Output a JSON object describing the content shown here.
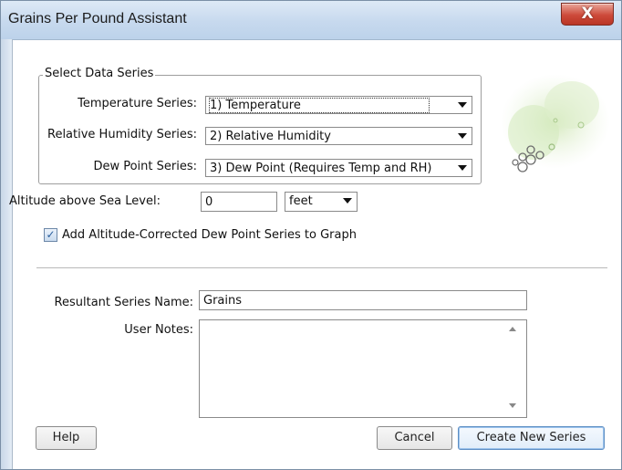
{
  "window": {
    "title": "Grains Per Pound Assistant",
    "close_glyph": "X"
  },
  "series_group": {
    "legend": "Select Data Series",
    "temperature": {
      "label": "Temperature Series:",
      "value": "1) Temperature"
    },
    "humidity": {
      "label": "Relative Humidity Series:",
      "value": "2) Relative Humidity"
    },
    "dew_point": {
      "label": "Dew Point Series:",
      "value": "3) Dew Point (Requires Temp and RH)"
    }
  },
  "altitude": {
    "label": "Altitude above Sea Level:",
    "value": "0",
    "unit": "feet"
  },
  "altitude_corrected": {
    "label": "Add Altitude-Corrected Dew Point Series to Graph",
    "checked": true,
    "check_glyph": "✓"
  },
  "resultant": {
    "label": "Resultant Series Name:",
    "value": "Grains"
  },
  "notes": {
    "label": "User Notes:",
    "value": ""
  },
  "buttons": {
    "help": "Help",
    "cancel": "Cancel",
    "create": "Create New Series"
  },
  "colors": {
    "titlebar": "#c7d9ee",
    "close": "#cd4a3a",
    "logo": "#b8d89a"
  },
  "icons": [
    "close-icon",
    "chevron-down-icon",
    "checkmark-icon",
    "bubbles-logo-icon"
  ]
}
